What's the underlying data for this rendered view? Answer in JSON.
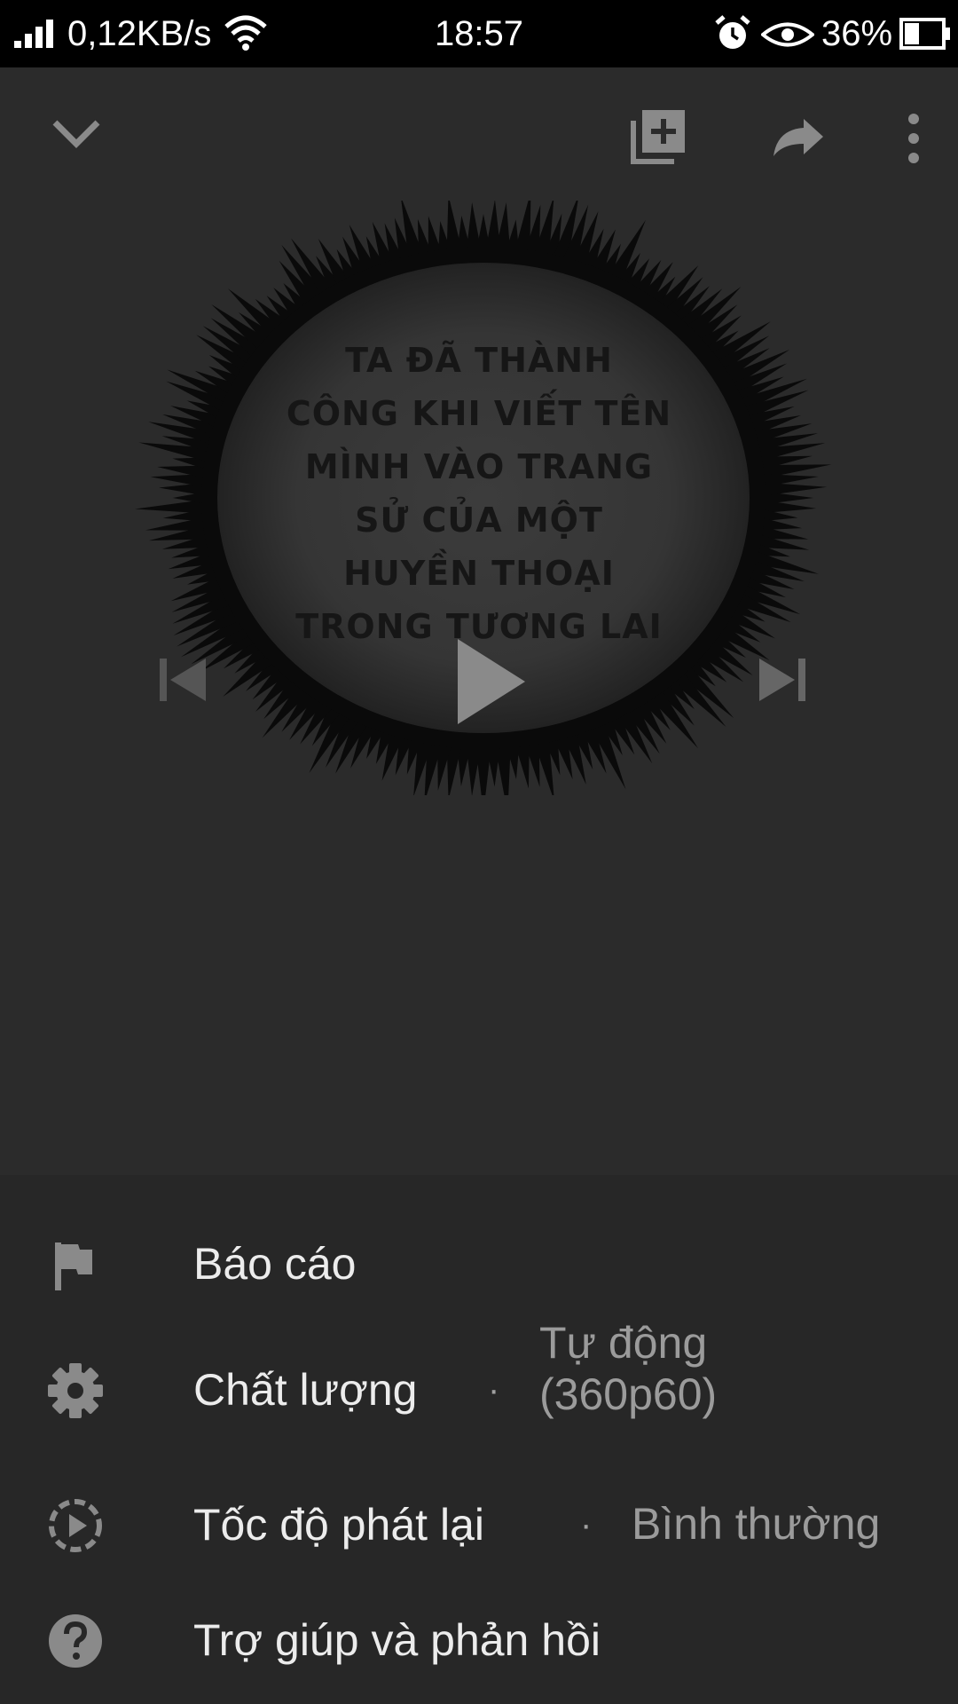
{
  "status_bar": {
    "net_speed": "0,12KB/s",
    "time": "18:57",
    "battery_percent": "36%"
  },
  "player": {
    "icons": [
      "chevron-down-icon",
      "add-to-playlist-icon",
      "share-icon",
      "more-vert-icon"
    ],
    "artwork_text": [
      "TA ĐÃ THÀNH",
      "CÔNG KHI VIẾT TÊN",
      "MÌNH VÀO TRANG",
      "SỬ CỦA MỘT",
      "HUYỀN THOẠI",
      "TRONG TƯƠNG LAI"
    ],
    "transport_icons": [
      "skip-previous-icon",
      "play-icon",
      "skip-next-icon"
    ]
  },
  "menu": {
    "report": {
      "label": "Báo cáo",
      "icon": "flag-icon"
    },
    "quality": {
      "label": "Chất lượng",
      "separator": "·",
      "value_line1": "Tự động",
      "value_line2": "(360p60)",
      "icon": "gear-icon"
    },
    "speed": {
      "label": "Tốc độ phát lại",
      "separator": "·",
      "value": "Bình thường",
      "icon": "playback-speed-icon"
    },
    "help": {
      "label": "Trợ giúp và phản hồi",
      "icon": "help-icon"
    }
  },
  "colors": {
    "background": "#2b2b2b",
    "menu_background": "#272727",
    "status_bar": "#000000",
    "icon_gray": "#8a8a8a",
    "text_primary": "#ececec",
    "text_secondary": "#9b9b9b"
  }
}
